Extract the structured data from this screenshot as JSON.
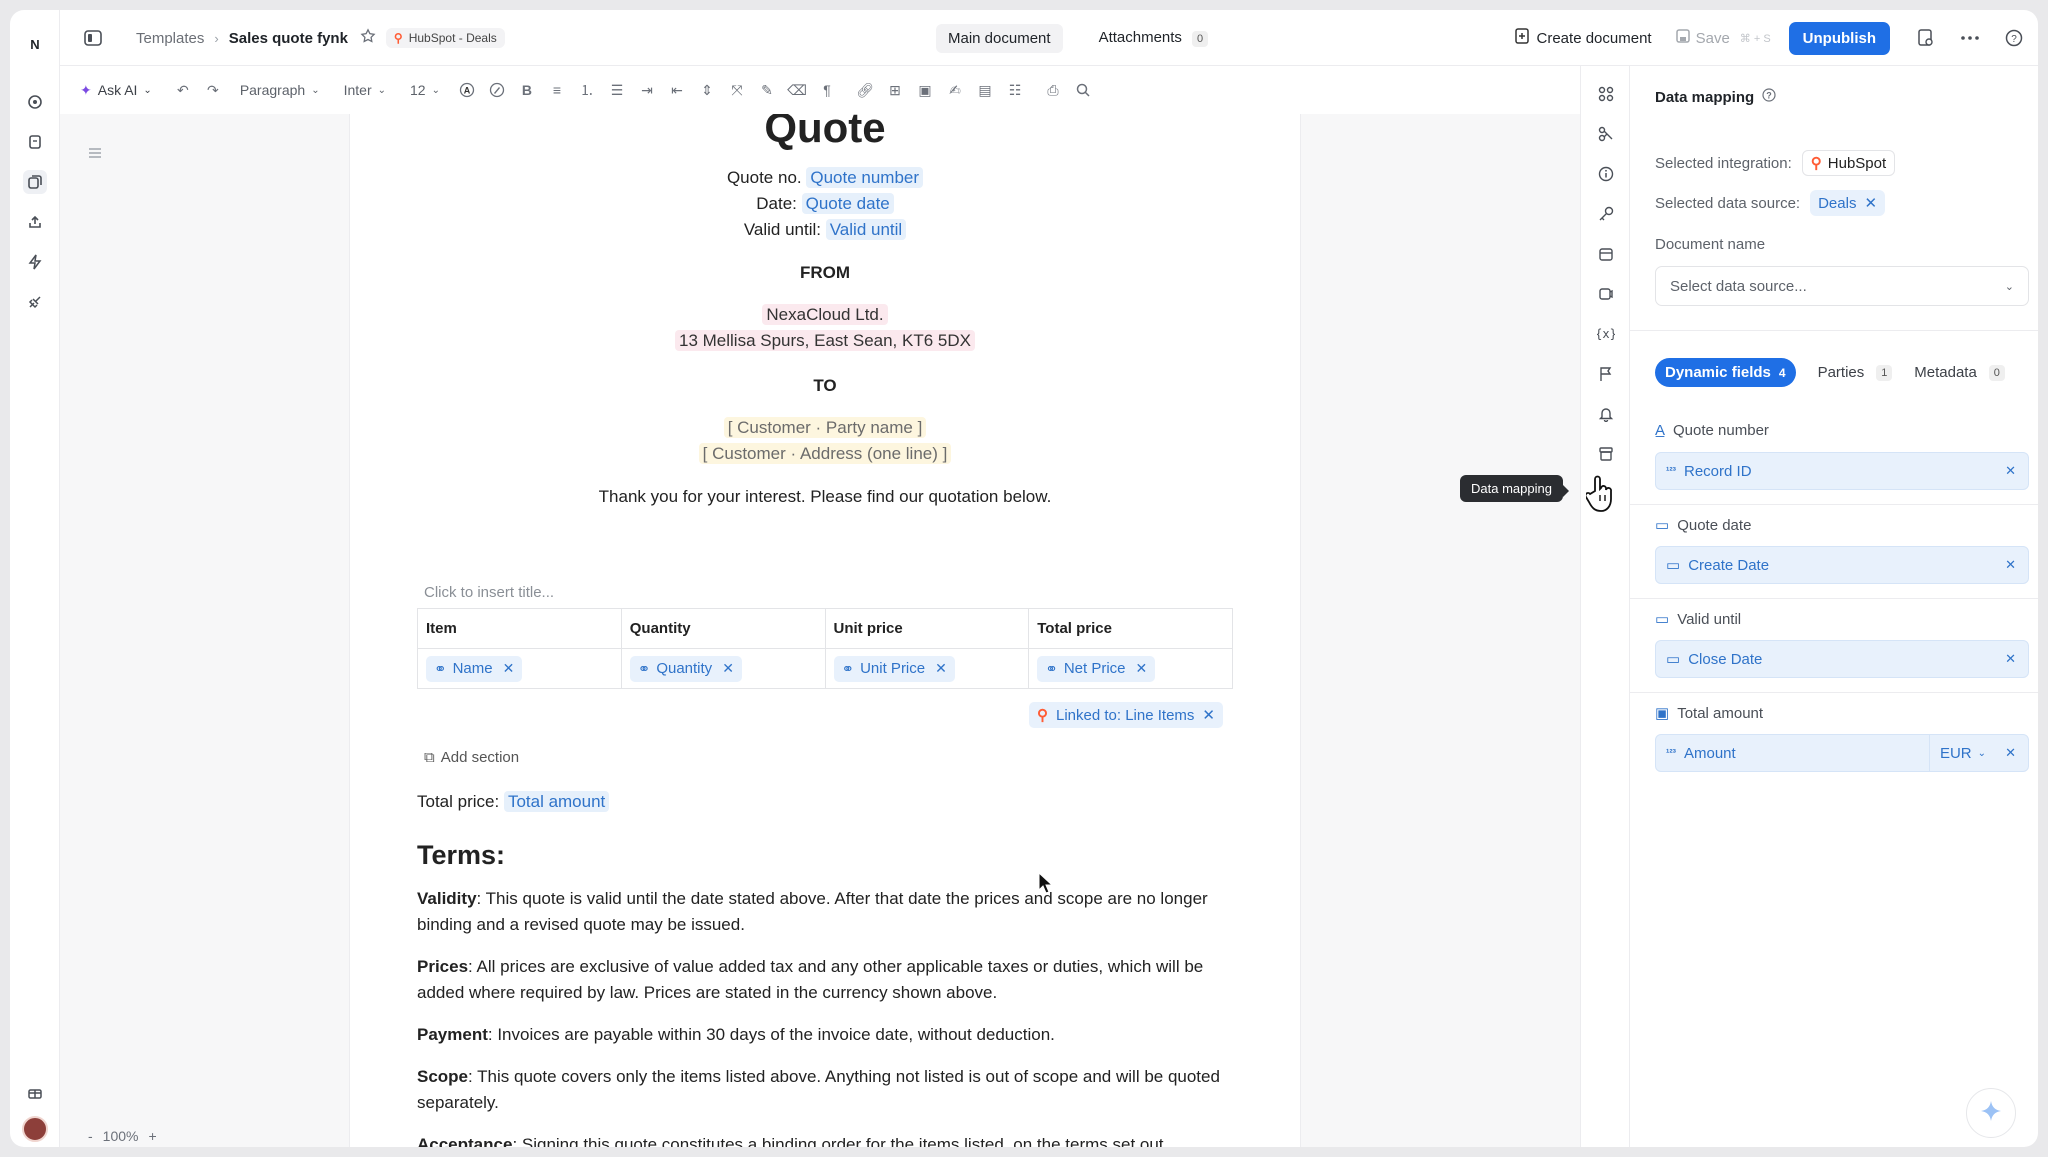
{
  "rail": {
    "logo": "N"
  },
  "breadcrumb": {
    "templates": "Templates",
    "doc_name": "Sales quote fynk",
    "integration_pill": "HubSpot - Deals"
  },
  "top_tabs": {
    "main_document": "Main document",
    "attachments": "Attachments",
    "attachments_count": "0"
  },
  "top_actions": {
    "create_document": "Create document",
    "save": "Save",
    "save_shortcut": "⌘ + S",
    "unpublish": "Unpublish"
  },
  "toolbar": {
    "ask_ai": "Ask AI",
    "paragraph": "Paragraph",
    "font": "Inter",
    "font_size": "12"
  },
  "document": {
    "title": "Quote",
    "quote_no_label": "Quote no.",
    "quote_no_field": "Quote number",
    "date_label": "Date:",
    "date_field": "Quote date",
    "valid_label": "Valid until:",
    "valid_field": "Valid until",
    "from_heading": "FROM",
    "from_company": "NexaCloud Ltd.",
    "from_address": "13 Mellisa Spurs, East Sean, KT6 5DX",
    "to_heading": "TO",
    "to_name": "[ Customer · Party name ]",
    "to_address": "[ Customer · Address (one line) ]",
    "intro": "Thank you for your interest. Please find our quotation below.",
    "table_title_placeholder": "Click to insert title...",
    "table_headers": [
      "Item",
      "Quantity",
      "Unit price",
      "Total price"
    ],
    "table_fields": [
      "Name",
      "Quantity",
      "Unit Price",
      "Net Price"
    ],
    "linked_to": "Linked to: Line Items",
    "add_section": "Add section",
    "total_label": "Total price:",
    "total_field": "Total amount",
    "terms_heading": "Terms:",
    "terms": [
      {
        "label": "Validity",
        "text": ": This quote is valid until the date stated above. After that date the prices and scope are no longer binding and a revised quote may be issued."
      },
      {
        "label": "Prices",
        "text": ": All prices are exclusive of value added tax and any other applicable taxes or duties, which will be added where required by law. Prices are stated in the currency shown above."
      },
      {
        "label": "Payment",
        "text": ": Invoices are payable within 30 days of the invoice date, without deduction."
      },
      {
        "label": "Scope",
        "text": ": This quote covers only the items listed above. Anything not listed is out of scope and will be quoted separately."
      },
      {
        "label": "Acceptance",
        "text": ": Signing this quote constitutes a binding order for the items listed, on the terms set out"
      }
    ]
  },
  "tooltip": "Data mapping",
  "panel": {
    "title": "Data mapping",
    "selected_integration_label": "Selected integration:",
    "selected_integration": "HubSpot",
    "selected_source_label": "Selected data source:",
    "selected_source": "Deals",
    "document_name_label": "Document name",
    "document_name_placeholder": "Select data source...",
    "tabs": [
      {
        "label": "Dynamic fields",
        "count": "4"
      },
      {
        "label": "Parties",
        "count": "1"
      },
      {
        "label": "Metadata",
        "count": "0"
      }
    ],
    "fields": [
      {
        "label": "Quote number",
        "value": "Record ID"
      },
      {
        "label": "Quote date",
        "value": "Create Date"
      },
      {
        "label": "Valid until",
        "value": "Close Date"
      },
      {
        "label": "Total amount",
        "value": "Amount",
        "currency": "EUR"
      }
    ]
  },
  "zoom": {
    "minus": "-",
    "level": "100%",
    "plus": "+"
  },
  "colors": {
    "primary": "#1f6fe5",
    "field_chip_bg": "#e8f1fc",
    "field_chip_text": "#2f73c9",
    "hubspot": "#ff5c35"
  }
}
